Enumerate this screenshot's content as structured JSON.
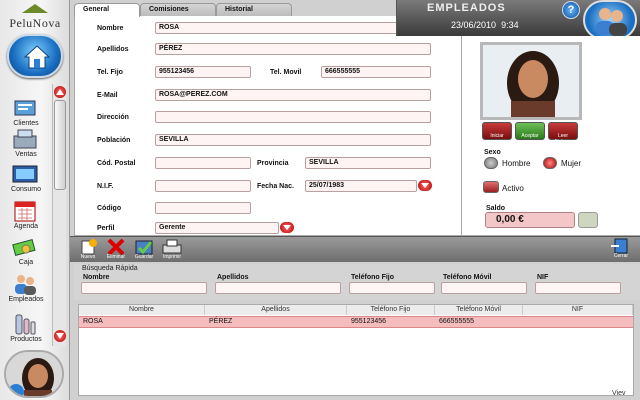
{
  "app": {
    "logo_text": "PeluNova"
  },
  "sidebar": {
    "items": [
      {
        "label": "Clientes",
        "icon": "clients-icon"
      },
      {
        "label": "Ventas",
        "icon": "sales-icon"
      },
      {
        "label": "Consumo",
        "icon": "consumption-icon"
      },
      {
        "label": "Agenda",
        "icon": "calendar-icon"
      },
      {
        "label": "Caja",
        "icon": "cash-icon"
      },
      {
        "label": "Empleados",
        "icon": "employees-icon"
      },
      {
        "label": "Productos",
        "icon": "products-icon"
      }
    ]
  },
  "tabs": [
    {
      "label": "General",
      "active": true
    },
    {
      "label": "Comisiones",
      "active": false
    },
    {
      "label": "Historial",
      "active": false
    }
  ],
  "header": {
    "title": "EMPLEADOS",
    "date": "23/06/2010",
    "time": "9:34",
    "help": "?"
  },
  "form": {
    "nombre": {
      "label": "Nombre",
      "value": "ROSA"
    },
    "apellidos": {
      "label": "Apellidos",
      "value": "PÉREZ"
    },
    "tel_fijo": {
      "label": "Tel. Fijo",
      "value": "955123456"
    },
    "tel_movil": {
      "label": "Tel. Movil",
      "value": "666555555"
    },
    "email": {
      "label": "E-Mail",
      "value": "ROSA@PEREZ.COM"
    },
    "direccion": {
      "label": "Dirección",
      "value": ""
    },
    "poblacion": {
      "label": "Población",
      "value": "SEVILLA"
    },
    "cod_postal": {
      "label": "Cód. Postal",
      "value": ""
    },
    "provincia": {
      "label": "Provincia",
      "value": "SEVILLA"
    },
    "nif": {
      "label": "N.I.F.",
      "value": ""
    },
    "fecha_nac": {
      "label": "Fecha Nac.",
      "value": "25/07/1983"
    },
    "codigo": {
      "label": "Código",
      "value": ""
    },
    "perfil": {
      "label": "Perfil",
      "value": "Gerente"
    }
  },
  "photo_buttons": [
    {
      "label": "Iniciar"
    },
    {
      "label": "Aceptar"
    },
    {
      "label": "Leer Fichero"
    }
  ],
  "sexo": {
    "label": "Sexo",
    "options": [
      "Hombre",
      "Mujer"
    ],
    "selected": "Mujer"
  },
  "activo": {
    "label": "Activo"
  },
  "saldo": {
    "label": "Saldo",
    "value": "0,00 €"
  },
  "toolbar": {
    "buttons": [
      {
        "label": "Nuevo"
      },
      {
        "label": "Eliminar"
      },
      {
        "label": "Guardar"
      },
      {
        "label": "Imprimir"
      }
    ],
    "close_label": "Cerrar"
  },
  "quick_search": {
    "title": "Búsqueda Rápida",
    "fields": [
      "Nombre",
      "Apellidos",
      "Teléfono Fijo",
      "Teléfono Móvil",
      "NIF"
    ]
  },
  "grid": {
    "columns": [
      "Nombre",
      "Apellidos",
      "Teléfono Fijo",
      "Teléfono Móvil",
      "NIF"
    ],
    "rows": [
      {
        "nombre": "ROSA",
        "apellidos": "PÉREZ",
        "tel_fijo": "955123456",
        "tel_movil": "666555555",
        "nif": ""
      }
    ]
  },
  "footer": {
    "viewer": "Viev"
  },
  "colors": {
    "accent_red": "#b10000",
    "field_bg": "#fff4f4",
    "selected_row": "#f4bcbc",
    "header_bg": "#3a3a3a"
  }
}
